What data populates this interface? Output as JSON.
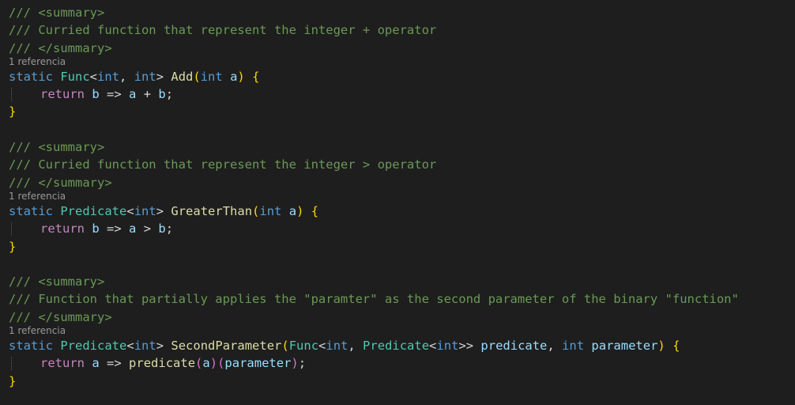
{
  "blocks": [
    {
      "doc_open": "/// <summary>",
      "doc_text": "/// Curried function that represent the integer + operator",
      "doc_close": "/// </summary>",
      "lens": "1 referencia",
      "sig": {
        "static": "static",
        "ret_type": "Func",
        "lt": "<",
        "t1": "int",
        "comma": ", ",
        "t2": "int",
        "gt": ">",
        "name": "Add",
        "lparen": "(",
        "ptype": "int",
        "pname": "a",
        "rparen": ")",
        "brace": "{"
      },
      "body": {
        "ret": "return",
        "lhs": "b",
        "arrow": "=>",
        "a": "a",
        "op": "+",
        "b": "b",
        "semi": ";"
      },
      "close": "}"
    },
    {
      "doc_open": "/// <summary>",
      "doc_text": "/// Curried function that represent the integer > operator",
      "doc_close": "/// </summary>",
      "lens": "1 referencia",
      "sig": {
        "static": "static",
        "ret_type": "Predicate",
        "lt": "<",
        "t1": "int",
        "gt": ">",
        "name": "GreaterThan",
        "lparen": "(",
        "ptype": "int",
        "pname": "a",
        "rparen": ")",
        "brace": "{"
      },
      "body": {
        "ret": "return",
        "lhs": "b",
        "arrow": "=>",
        "a": "a",
        "op": ">",
        "b": "b",
        "semi": ";"
      },
      "close": "}"
    },
    {
      "doc_open": "/// <summary>",
      "doc_text": "/// Function that partially applies the \"paramter\" as the second parameter of the binary \"function\"",
      "doc_close": "/// </summary>",
      "lens": "1 referencia",
      "sig": {
        "static": "static",
        "ret_type": "Predicate",
        "lt": "<",
        "t1": "int",
        "gt": ">",
        "name": "SecondParameter",
        "lparen": "(",
        "p1_type": "Func",
        "p1_lt": "<",
        "p1_t1": "int",
        "p1_comma": ", ",
        "p1_t2": "Predicate",
        "p1_lt2": "<",
        "p1_t3": "int",
        "p1_gt": ">>",
        "p1_name": "predicate",
        "p2_comma": ", ",
        "p2_type": "int",
        "p2_name": "parameter",
        "rparen": ")",
        "brace": "{"
      },
      "body": {
        "ret": "return",
        "lhs": "a",
        "arrow": "=>",
        "call": "predicate",
        "lp1": "(",
        "arg1": "a",
        "rp1": ")",
        "lp2": "(",
        "arg2": "parameter",
        "rp2": ")",
        "semi": ";"
      },
      "close": "}"
    }
  ]
}
